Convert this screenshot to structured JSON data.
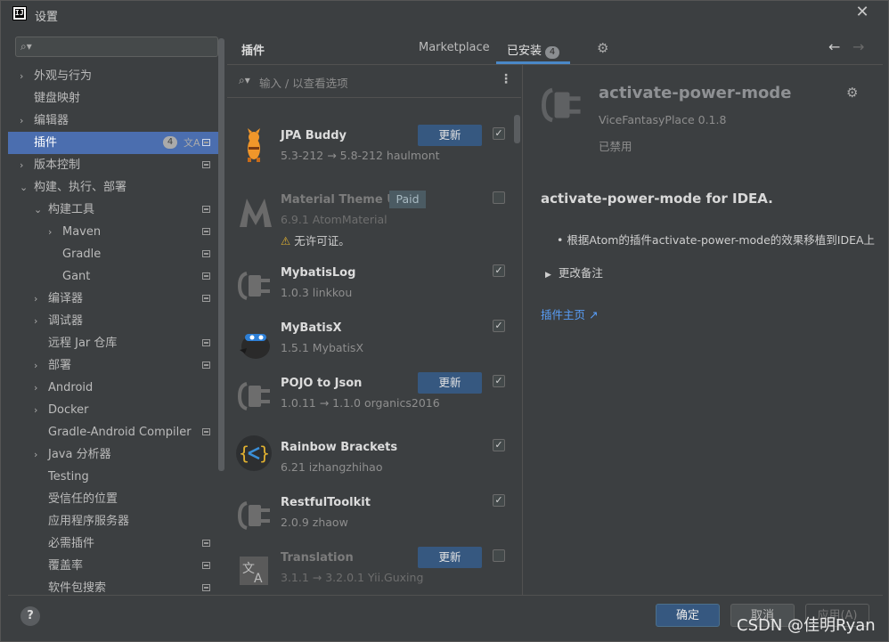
{
  "window": {
    "title": "设置",
    "app_icon_label": "IJ"
  },
  "left_panel": {
    "search_placeholder": "",
    "items": [
      {
        "label": "外观与行为"
      },
      {
        "label": "键盘映射"
      },
      {
        "label": "编辑器"
      },
      {
        "label": "插件",
        "badge": "4"
      },
      {
        "label": "版本控制"
      },
      {
        "label": "构建、执行、部署"
      },
      {
        "label": "构建工具"
      },
      {
        "label": "Maven"
      },
      {
        "label": "Gradle"
      },
      {
        "label": "Gant"
      },
      {
        "label": "编译器"
      },
      {
        "label": "调试器"
      },
      {
        "label": "远程 Jar 仓库"
      },
      {
        "label": "部署"
      },
      {
        "label": "Android"
      },
      {
        "label": "Docker"
      },
      {
        "label": "Gradle-Android Compiler"
      },
      {
        "label": "Java 分析器"
      },
      {
        "label": "Testing"
      },
      {
        "label": "受信任的位置"
      },
      {
        "label": "应用程序服务器"
      },
      {
        "label": "必需插件"
      },
      {
        "label": "覆盖率"
      },
      {
        "label": "软件包搜索"
      }
    ]
  },
  "header": {
    "title": "插件",
    "tabs": [
      {
        "label": "Marketplace"
      },
      {
        "label": "已安装",
        "count": "4"
      }
    ]
  },
  "plugin_list": {
    "search_placeholder": "输入 / 以查看选项",
    "plugins": [
      {
        "name": "JPA Buddy",
        "meta": "5.3-212 → 5.8-212  haulmont",
        "update_label": "更新",
        "enabled": true
      },
      {
        "name": "Material Theme UI",
        "paid_label": "Paid",
        "meta": "6.9.1  AtomMaterial",
        "warning": "无许可证。",
        "enabled": false
      },
      {
        "name": "MybatisLog",
        "meta": "1.0.3  linkkou",
        "enabled": true
      },
      {
        "name": "MyBatisX",
        "meta": "1.5.1  MybatisX",
        "enabled": true
      },
      {
        "name": "POJO to Json",
        "meta": "1.0.11 → 1.1.0  organics2016",
        "update_label": "更新",
        "enabled": true
      },
      {
        "name": "Rainbow Brackets",
        "meta": "6.21  izhangzhihao",
        "enabled": true
      },
      {
        "name": "RestfulToolkit",
        "meta": "2.0.9  zhaow",
        "enabled": true
      },
      {
        "name": "Translation",
        "meta": "3.1.1 → 3.2.0.1  Yii.Guxing",
        "update_label": "更新",
        "enabled": false
      }
    ]
  },
  "detail": {
    "name": "activate-power-mode",
    "vendor": "ViceFantasyPlace   0.1.8",
    "status": "已禁用",
    "heading": "activate-power-mode for IDEA.",
    "bullet": "根据Atom的插件activate-power-mode的效果移植到IDEA上",
    "change_notes": "更改备注",
    "homepage": "插件主页 ↗"
  },
  "footer": {
    "help": "?",
    "ok": "确定",
    "cancel": "取消",
    "apply": "应用(A)"
  },
  "watermark": "CSDN @佳明Ryan",
  "colors": {
    "accent": "#4b6eaf",
    "button_primary": "#365880",
    "link": "#589df6",
    "background": "#3c3f41"
  }
}
